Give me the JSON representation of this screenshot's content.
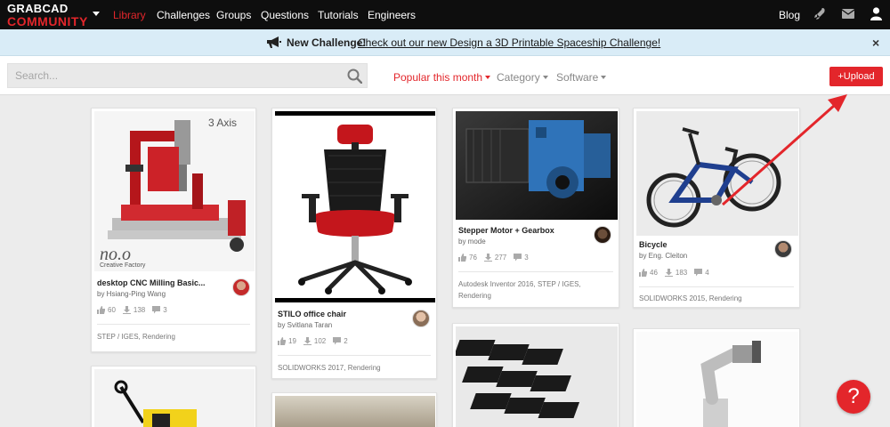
{
  "logo": {
    "line1": "GRABCAD",
    "line2": "COMMUNITY"
  },
  "nav": {
    "items": [
      {
        "label": "Library",
        "active": true
      },
      {
        "label": "Challenges"
      },
      {
        "label": "Groups"
      },
      {
        "label": "Questions"
      },
      {
        "label": "Tutorials"
      },
      {
        "label": "Engineers"
      }
    ],
    "blog": "Blog",
    "icons": [
      "rocket-icon",
      "mail-icon",
      "user-icon"
    ]
  },
  "banner": {
    "title": "New Challenge!",
    "link": "Check out our new Design a 3D Printable Spaceship Challenge!",
    "close": "×"
  },
  "toolbar": {
    "search_placeholder": "Search...",
    "filters": {
      "popular": "Popular this month",
      "category": "Category",
      "software": "Software"
    },
    "upload": "+Upload"
  },
  "cards": [
    {
      "title": "desktop CNC Milling Basic...",
      "author": "by Hsiang-Ping Wang",
      "likes": "60",
      "downloads": "138",
      "comments": "3",
      "tags": "STEP / IGES, Rendering",
      "thumb_text_1": "3 Axis",
      "thumb_text_2": "Creative Factory"
    },
    {
      "title": "STILO office chair",
      "author": "by Svitlana Taran",
      "likes": "19",
      "downloads": "102",
      "comments": "2",
      "tags": "SOLIDWORKS 2017, Rendering"
    },
    {
      "title": "Stepper Motor + Gearbox",
      "author": "by mode",
      "likes": "76",
      "downloads": "277",
      "comments": "3",
      "tags_line1": "Autodesk Inventor 2016, STEP / IGES,",
      "tags_line2": "Rendering"
    },
    {
      "title": "Bicycle",
      "author": "by Eng. Cleiton",
      "likes": "46",
      "downloads": "183",
      "comments": "4",
      "tags": "SOLIDWORKS 2015, Rendering"
    }
  ],
  "help": "?",
  "colors": {
    "brand_red": "#e3262b",
    "nav_bg": "#0e0e0e",
    "banner_bg": "#d9ecf7"
  }
}
